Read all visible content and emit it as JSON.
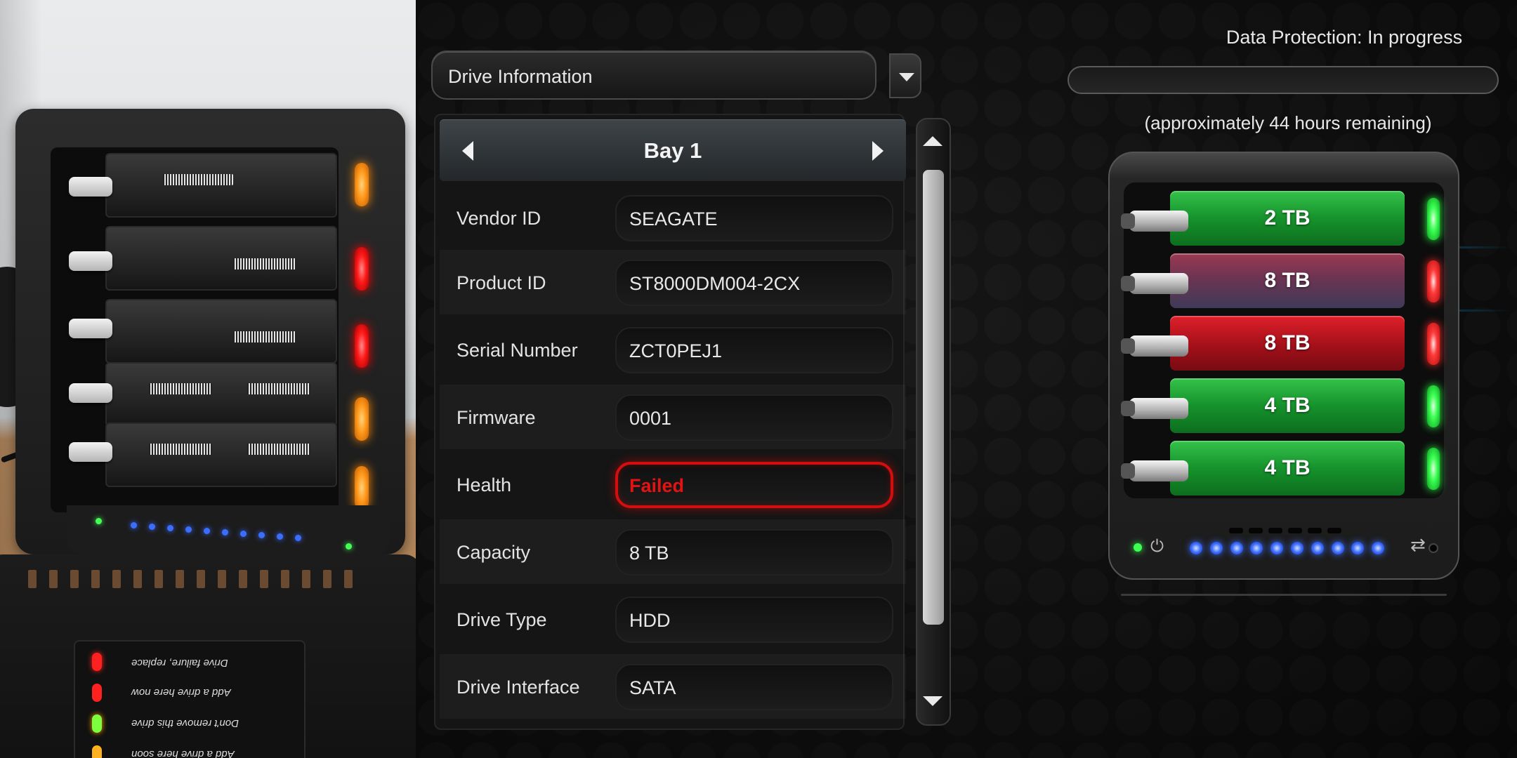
{
  "dropdown": {
    "label": "Drive Information"
  },
  "bay_panel": {
    "title": "Bay 1",
    "fields": [
      {
        "label": "Vendor ID",
        "value": "SEAGATE"
      },
      {
        "label": "Product ID",
        "value": "ST8000DM004-2CX"
      },
      {
        "label": "Serial Number",
        "value": "ZCT0PEJ1"
      },
      {
        "label": "Firmware",
        "value": "0001"
      },
      {
        "label": "Health",
        "value": "Failed"
      },
      {
        "label": "Capacity",
        "value": "8 TB"
      },
      {
        "label": "Drive Type",
        "value": "HDD"
      },
      {
        "label": "Drive Interface",
        "value": "SATA"
      }
    ]
  },
  "status": {
    "text": "Data Protection: In progress",
    "remaining": "(approximately 44 hours remaining)",
    "progress_fraction": 0.0
  },
  "device": {
    "bays": [
      {
        "capacity": "2 TB",
        "state": "green"
      },
      {
        "capacity": "8 TB",
        "state": "selected"
      },
      {
        "capacity": "8 TB",
        "state": "red"
      },
      {
        "capacity": "4 TB",
        "state": "green"
      },
      {
        "capacity": "4 TB",
        "state": "green"
      }
    ],
    "activity_led_count": 10,
    "colors": {
      "healthy": "#16922c",
      "failed": "#a3101a",
      "activity": "#3c6cff",
      "alert": "#d10f0f"
    }
  },
  "photo": {
    "sticker_lines": [
      "Drive failure, replace",
      "Add a drive here now",
      "Don't remove this drive",
      "Add a drive here soon"
    ]
  },
  "icons": {
    "dropdown": "chevron-down-icon",
    "prev": "chevron-left-icon",
    "next": "chevron-right-icon",
    "power": "power-icon",
    "swap": "swap-arrows-icon"
  }
}
